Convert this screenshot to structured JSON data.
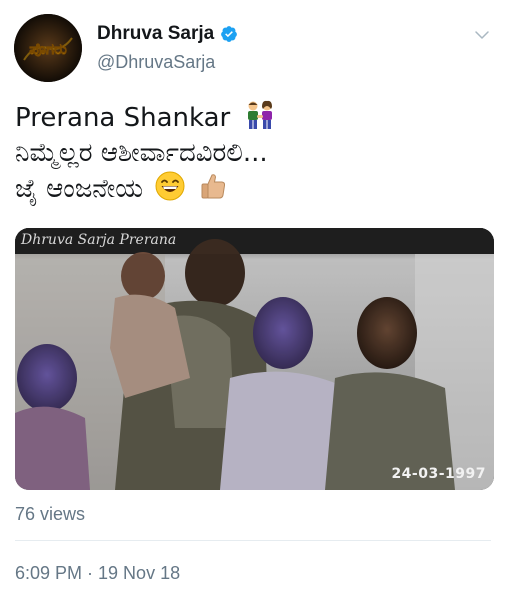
{
  "author": {
    "name": "Dhruva Sarja",
    "handle": "@DhruvaSarja",
    "verified": true,
    "avatar_text": "ಪೊಗರು"
  },
  "tweet": {
    "lines": [
      "Prerana Shankar",
      "ನಿಮ್ಮೆಲ್ಲರ ಆಶೀರ್ವಾದವಿರಲಿ...",
      "ಜೈ ಆಂಜನೇಯ"
    ],
    "emojis": [
      "man-and-woman-holding-hands-emoji",
      "grinning-face-emoji",
      "thumbs-up-emoji"
    ]
  },
  "media": {
    "title_overlay": "Dhruva Sarja Prerana",
    "date_overlay": "24-03-1997"
  },
  "stats": {
    "views": "76 views"
  },
  "meta": {
    "timestamp": "6:09 PM · 19 Nov 18"
  },
  "colors": {
    "accent": "#1da1f2",
    "secondary_text": "#657786",
    "primary_text": "#14171a",
    "divider": "#e6ecf0"
  }
}
